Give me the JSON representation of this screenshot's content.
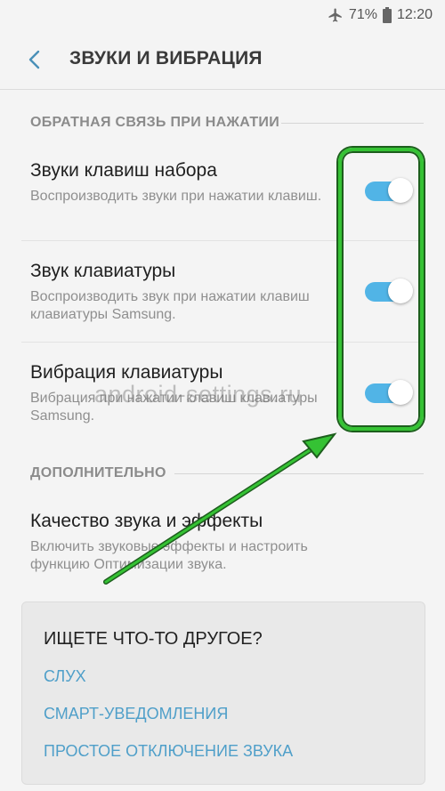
{
  "status": {
    "battery": "71%",
    "time": "12:20"
  },
  "header": {
    "title": "ЗВУКИ И ВИБРАЦИЯ"
  },
  "section1": {
    "title": "ОБРАТНАЯ СВЯЗЬ ПРИ НАЖАТИИ"
  },
  "settings": [
    {
      "title": "Звуки клавиш набора",
      "subtitle": "Воспроизводить звуки при нажатии клавиш.",
      "enabled": true
    },
    {
      "title": "Звук клавиатуры",
      "subtitle": "Воспроизводить звук при нажатии клавиш клавиатуры Samsung.",
      "enabled": true
    },
    {
      "title": "Вибрация клавиатуры",
      "subtitle": "Вибрация при нажатии клавиш клавиатуры Samsung.",
      "enabled": true
    }
  ],
  "section2": {
    "title": "ДОПОЛНИТЕЛЬНО"
  },
  "extra_item": {
    "title": "Качество звука и эффекты",
    "subtitle": "Включить звуковые эффекты и настроить функцию Оптимизации звука."
  },
  "watermark": "android-settings.ru",
  "suggest": {
    "title": "ИЩЕТЕ ЧТО-ТО ДРУГОЕ?",
    "links": [
      "СЛУХ",
      "СМАРТ-УВЕДОМЛЕНИЯ",
      "ПРОСТОЕ ОТКЛЮЧЕНИЕ ЗВУКА"
    ]
  },
  "colors": {
    "toggle_on": "#51b4e6",
    "highlight": "#35c234",
    "link": "#4f9fc9"
  }
}
